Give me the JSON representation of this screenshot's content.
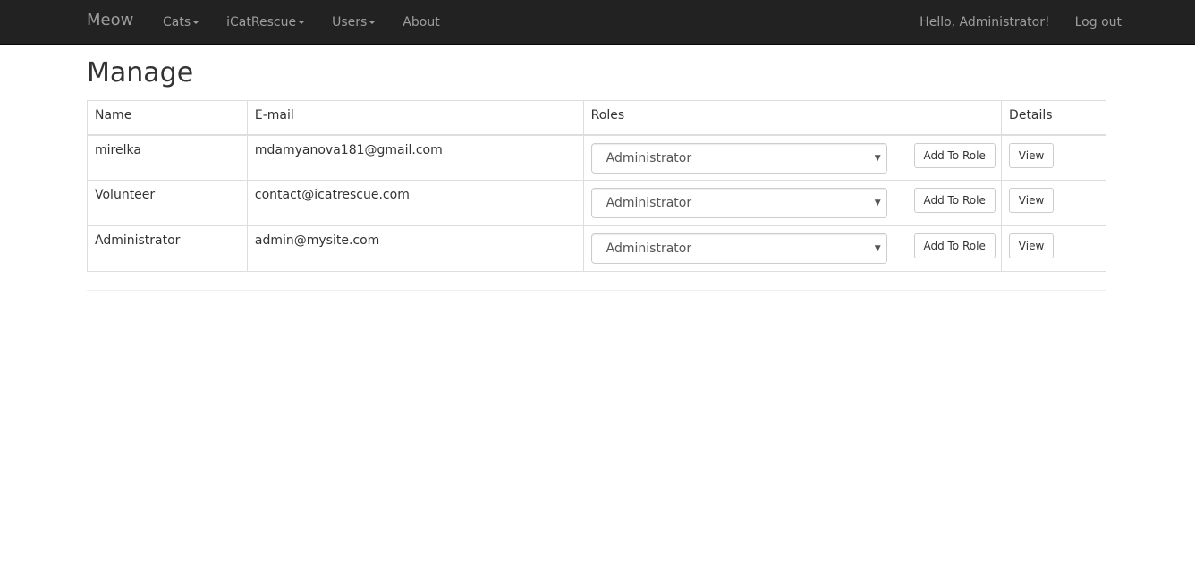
{
  "navbar": {
    "brand": "Meow",
    "menu": [
      {
        "label": "Cats",
        "dropdown": true
      },
      {
        "label": "iCatRescue",
        "dropdown": true
      },
      {
        "label": "Users",
        "dropdown": true
      },
      {
        "label": "About",
        "dropdown": false
      }
    ],
    "greeting": "Hello, Administrator!",
    "logout": "Log out"
  },
  "page": {
    "title": "Manage"
  },
  "table": {
    "headers": {
      "name": "Name",
      "email": "E-mail",
      "roles": "Roles",
      "details": "Details"
    },
    "rows": [
      {
        "name": "mirelka",
        "email": "mdamyanova181@gmail.com",
        "role": "Administrator",
        "add_label": "Add To Role",
        "view_label": "View"
      },
      {
        "name": "Volunteer",
        "email": "contact@icatrescue.com",
        "role": "Administrator",
        "add_label": "Add To Role",
        "view_label": "View"
      },
      {
        "name": "Administrator",
        "email": "admin@mysite.com",
        "role": "Administrator",
        "add_label": "Add To Role",
        "view_label": "View"
      }
    ]
  },
  "colors": {
    "navbar_bg": "#222222",
    "nav_text": "#9d9d9d",
    "text": "#333333",
    "border": "#dddddd"
  }
}
